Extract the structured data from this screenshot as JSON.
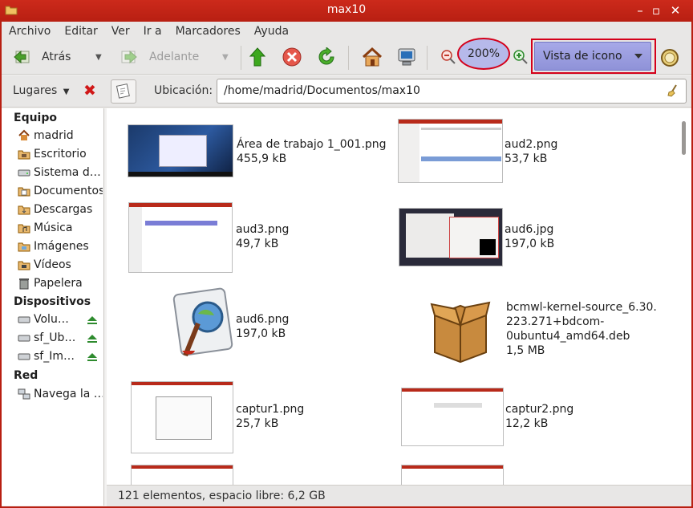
{
  "window": {
    "title": "max10"
  },
  "menu": {
    "items": [
      "Archivo",
      "Editar",
      "Ver",
      "Ir a",
      "Marcadores",
      "Ayuda"
    ]
  },
  "toolbar": {
    "back_label": "Atrás",
    "forward_label": "Adelante",
    "zoom_level": "200%",
    "view_mode": "Vista de icono"
  },
  "location": {
    "places_label": "Lugares",
    "label": "Ubicación:",
    "path": "/home/madrid/Documentos/max10"
  },
  "sidebar": {
    "sections": [
      {
        "title": "Equipo",
        "items": [
          "madrid",
          "Escritorio",
          "Sistema d…",
          "Documentos",
          "Descargas",
          "Música",
          "Imágenes",
          "Vídeos",
          "Papelera"
        ]
      },
      {
        "title": "Dispositivos",
        "items": [
          "Volu…",
          "sf_Ub…",
          "sf_Im…"
        ]
      },
      {
        "title": "Red",
        "items": [
          "Navega la …"
        ]
      }
    ]
  },
  "files": [
    {
      "name": "Área de trabajo 1_001.png",
      "size": "455,9 kB"
    },
    {
      "name": "aud2.png",
      "size": "53,7 kB"
    },
    {
      "name": "aud3.png",
      "size": "49,7 kB"
    },
    {
      "name": "aud6.jpg",
      "size": "197,0 kB"
    },
    {
      "name": "aud6.png",
      "size": "197,0 kB"
    },
    {
      "name_lines": [
        "bcmwl-kernel-source_6.30.",
        "223.271+bdcom-",
        "0ubuntu4_amd64.deb"
      ],
      "size": "1,5 MB"
    },
    {
      "name": "captur1.png",
      "size": "25,7 kB"
    },
    {
      "name": "captur2.png",
      "size": "12,2 kB"
    }
  ],
  "status": {
    "text": "121 elementos, espacio libre: 6,2 GB"
  },
  "colors": {
    "titlebar": "#c42617",
    "highlight": "#d4001a",
    "selection": "#9ea1e2"
  }
}
